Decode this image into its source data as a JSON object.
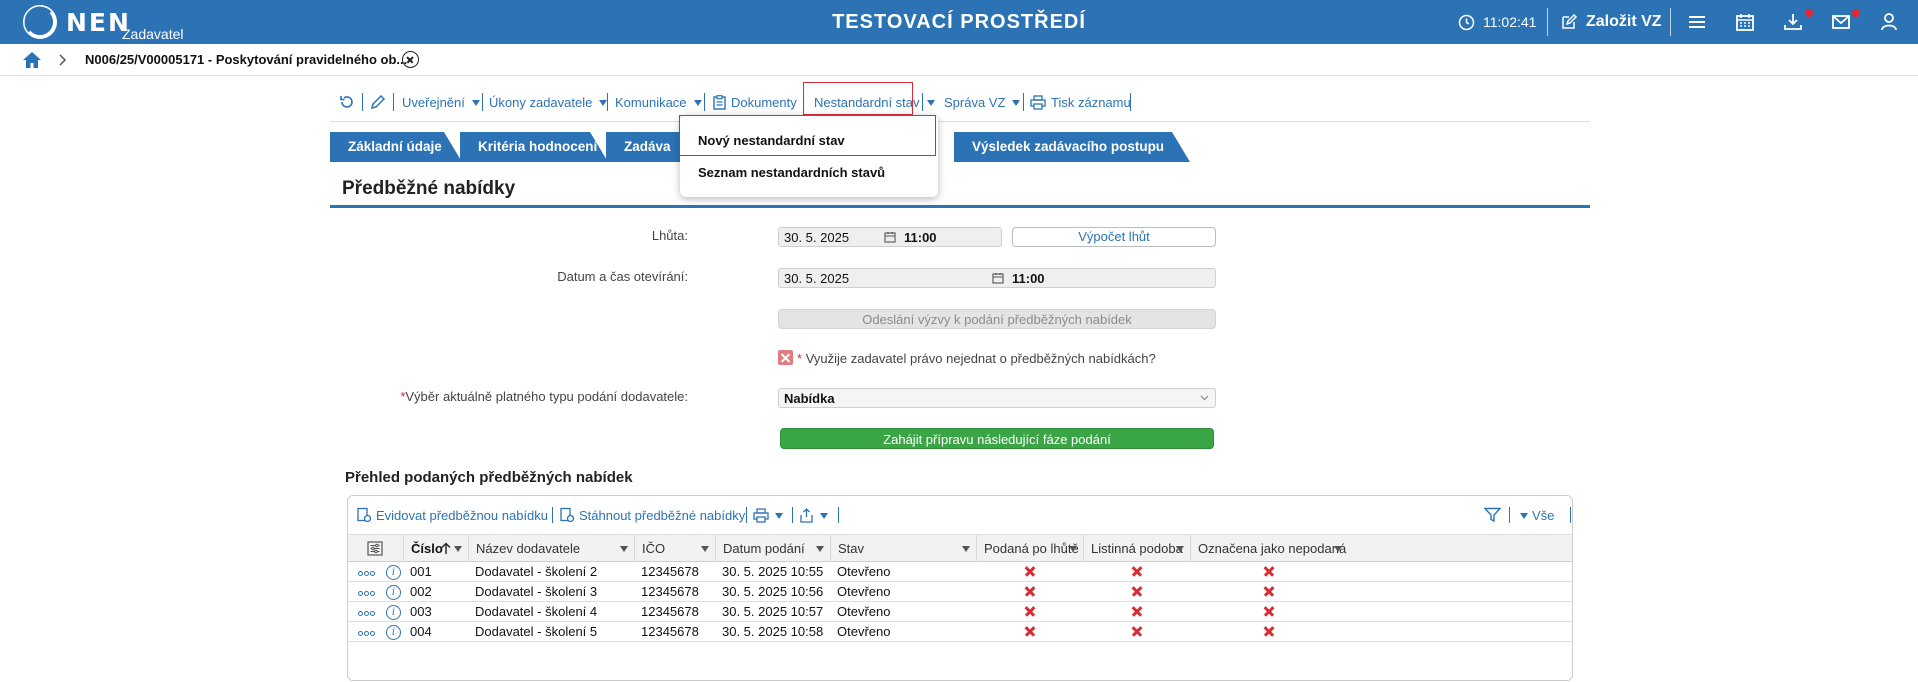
{
  "app": {
    "logo_text": "NEN",
    "logo_sub": "Zadavatel",
    "environment_title": "TESTOVACÍ PROSTŘEDÍ",
    "time": "11:02:41",
    "zalozit_label": "Založit VZ",
    "icons": [
      "clock-icon",
      "edit-icon",
      "menu-icon",
      "calendar-icon",
      "download-icon",
      "mail-icon",
      "user-icon"
    ],
    "accent_color": "#2c73b5"
  },
  "breadcrumb": {
    "title": "N006/25/V00005171 - Poskytování pravidelného ob..."
  },
  "toolbar": {
    "items": [
      {
        "label": "Uveřejnění"
      },
      {
        "label": "Úkony zadavatele"
      },
      {
        "label": "Komunikace"
      },
      {
        "label": "Dokumenty"
      },
      {
        "label": "Nestandardní stav"
      },
      {
        "label": "Správa VZ"
      },
      {
        "label": "Tisk záznamu"
      }
    ]
  },
  "dropdown": {
    "items": [
      "Nový nestandardní stav",
      "Seznam nestandardních stavů"
    ]
  },
  "tabs": [
    "Základní údaje",
    "Kritéria hodnocení",
    "Zadáva",
    "Výsledek zadávacího postupu"
  ],
  "form": {
    "title": "Předběžné nabídky",
    "lhuta_label": "Lhůta:",
    "lhuta_date": "30. 5. 2025",
    "lhuta_time": "11:00",
    "vypocet_label": "Výpočet lhůt",
    "otevirani_label": "Datum a čas otevírání:",
    "otevirani_date": "30. 5. 2025",
    "otevirani_time": "11:00",
    "odeslani_label": "Odeslání výzvy k podání předběžných nabídek",
    "pravo_label": "Využije zadavatel právo nejednat o předběžných nabídkách?",
    "vyber_label": "Výběr aktuálně platného typu podání dodavatele:",
    "vyber_value": "Nabídka",
    "zahajit_label": "Zahájit přípravu následující fáze podání"
  },
  "grid": {
    "section_title": "Přehled podaných předběžných nabídek",
    "evidovat_label": "Evidovat předběžnou nabídku",
    "stahnout_label": "Stáhnout předběžné nabídky",
    "filter_label": "Vše",
    "columns": [
      "Číslo",
      "Název dodavatele",
      "IČO",
      "Datum podání",
      "Stav",
      "Podaná po lhůtě",
      "Listinná podoba",
      "Označena jako nepodaná"
    ],
    "rows": [
      {
        "cislo": "001",
        "nazev": "Dodavatel - školení 2",
        "ico": "12345678",
        "datum": "30. 5. 2025 10:55",
        "stav": "Otevřeno"
      },
      {
        "cislo": "002",
        "nazev": "Dodavatel - školení 3",
        "ico": "12345678",
        "datum": "30. 5. 2025 10:56",
        "stav": "Otevřeno"
      },
      {
        "cislo": "003",
        "nazev": "Dodavatel - školení 4",
        "ico": "12345678",
        "datum": "30. 5. 2025 10:57",
        "stav": "Otevřeno"
      },
      {
        "cislo": "004",
        "nazev": "Dodavatel - školení 5",
        "ico": "12345678",
        "datum": "30. 5. 2025 10:58",
        "stav": "Otevřeno"
      }
    ]
  }
}
